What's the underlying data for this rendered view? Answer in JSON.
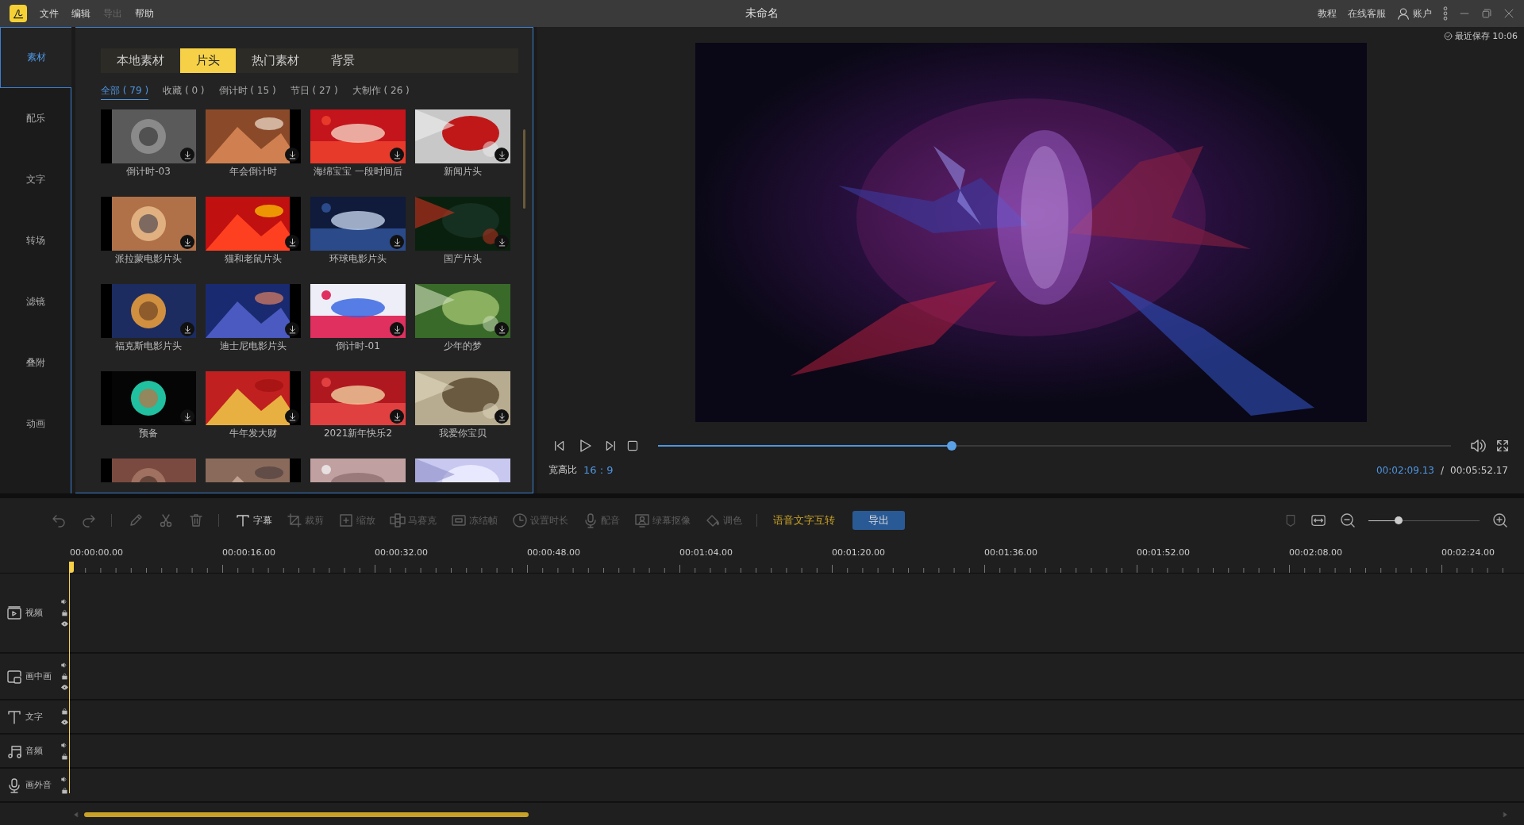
{
  "titlebar": {
    "menu": [
      {
        "label": "文件",
        "disabled": false
      },
      {
        "label": "编辑",
        "disabled": false
      },
      {
        "label": "导出",
        "disabled": true
      },
      {
        "label": "帮助",
        "disabled": false
      }
    ],
    "title": "未命名",
    "links": [
      "教程",
      "在线客服"
    ],
    "account": "账户"
  },
  "sidebar": {
    "items": [
      {
        "label": "素材",
        "selected": true
      },
      {
        "label": "配乐",
        "selected": false
      },
      {
        "label": "文字",
        "selected": false
      },
      {
        "label": "转场",
        "selected": false
      },
      {
        "label": "滤镜",
        "selected": false
      },
      {
        "label": "叠附",
        "selected": false
      },
      {
        "label": "动画",
        "selected": false
      }
    ]
  },
  "library": {
    "tabs": [
      {
        "label": "本地素材",
        "selected": false
      },
      {
        "label": "片头",
        "selected": true
      },
      {
        "label": "热门素材",
        "selected": false
      },
      {
        "label": "背景",
        "selected": false
      }
    ],
    "filters": [
      {
        "label": "全部 ( 79 )",
        "selected": true
      },
      {
        "label": "收藏 ( 0 )",
        "selected": false
      },
      {
        "label": "倒计时 ( 15 )",
        "selected": false
      },
      {
        "label": "节日 ( 27 )",
        "selected": false
      },
      {
        "label": "大制作 ( 26 )",
        "selected": false
      }
    ],
    "items": [
      {
        "kind": "clip",
        "title": "倒计时-03"
      },
      {
        "kind": "clip",
        "title": "年会倒计时"
      },
      {
        "kind": "clip",
        "title": "海绵宝宝 一段时间后"
      },
      {
        "kind": "clip",
        "title": "新闻片头"
      },
      {
        "kind": "clip",
        "title": "派拉蒙电影片头"
      },
      {
        "kind": "clip",
        "title": "猫和老鼠片头"
      },
      {
        "kind": "clip",
        "title": "环球电影片头"
      },
      {
        "kind": "clip",
        "title": "国产片头"
      },
      {
        "kind": "clip",
        "title": "福克斯电影片头"
      },
      {
        "kind": "clip",
        "title": "迪士尼电影片头"
      },
      {
        "kind": "clip",
        "title": "倒计时-01"
      },
      {
        "kind": "clip",
        "title": "少年的梦"
      },
      {
        "kind": "clip",
        "title": "预备"
      },
      {
        "kind": "clip",
        "title": "牛年发大财"
      },
      {
        "kind": "clip",
        "title": "2021新年快乐2"
      },
      {
        "kind": "clip",
        "title": "我爱你宝贝"
      },
      {
        "kind": "partial"
      },
      {
        "kind": "partial"
      },
      {
        "kind": "partial"
      },
      {
        "kind": "partial"
      }
    ]
  },
  "preview": {
    "saved": "最近保存 10:06",
    "level": 0.37,
    "aspect_label": "宽高比",
    "aspect_value": "16 : 9",
    "current_time": "00:02:09.13",
    "separator": "/",
    "total_time": "00:05:52.17"
  },
  "toolbar": {
    "tools": [
      {
        "kind": "undo",
        "disabled": true
      },
      {
        "kind": "redo",
        "disabled": true
      },
      {
        "kind": "pencil",
        "disabled": true
      },
      {
        "kind": "scissors",
        "disabled": true
      },
      {
        "kind": "trash",
        "disabled": true
      },
      {
        "kind": "subtitle",
        "label": "字幕",
        "disabled": false
      },
      {
        "kind": "crop",
        "label": "裁剪",
        "disabled": true
      },
      {
        "kind": "zoom",
        "label": "缩放",
        "disabled": true
      },
      {
        "kind": "mosaic",
        "label": "马赛克",
        "disabled": true
      },
      {
        "kind": "freeze",
        "label": "冻结帧",
        "disabled": true
      },
      {
        "kind": "duration",
        "label": "设置时长",
        "disabled": true
      },
      {
        "kind": "dub",
        "label": "配音",
        "disabled": true
      },
      {
        "kind": "greenscreen",
        "label": "绿幕抠像",
        "disabled": true
      },
      {
        "kind": "color",
        "label": "调色",
        "disabled": true
      }
    ],
    "speech": "语音文字互转",
    "export": "导出",
    "zoom": {
      "level": 0.27
    }
  },
  "timeline": {
    "ruler": [
      "00:00:00.00",
      "00:00:16.00",
      "00:00:32.00",
      "00:00:48.00",
      "00:01:04.00",
      "00:01:20.00",
      "00:01:36.00",
      "00:01:52.00",
      "00:02:08.00",
      "00:02:24.00"
    ],
    "tracks": [
      {
        "kind": "video",
        "label": "视频"
      },
      {
        "kind": "pip",
        "label": "画中画"
      },
      {
        "kind": "text",
        "label": "文字"
      },
      {
        "kind": "audio",
        "label": "音频"
      },
      {
        "kind": "voice",
        "label": "画外音"
      }
    ]
  }
}
